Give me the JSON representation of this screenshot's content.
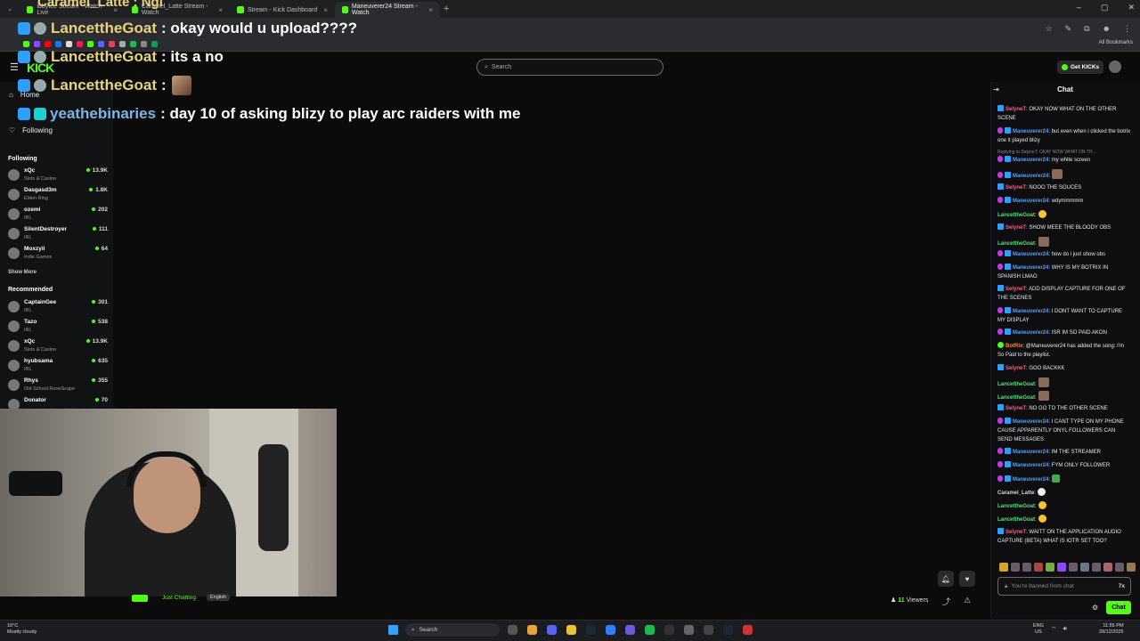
{
  "browser": {
    "tabs": [
      {
        "label": "ibbytee Stream - Watch Live"
      },
      {
        "label": "Caramel_Latte Stream - Watch"
      },
      {
        "label": "Stream - Kick Dashboard"
      },
      {
        "label": "Maneuverer24 Stream - Watch"
      }
    ],
    "all_bookmarks": "All Bookmarks"
  },
  "kick": {
    "logo": "KICK",
    "search_placeholder": "Search",
    "get_kicks": "Get KICKs"
  },
  "sidebar": {
    "nav": [
      {
        "label": "Home"
      },
      {
        "label": "Following"
      }
    ],
    "following_heading": "Following",
    "following": [
      {
        "name": "xQc",
        "category": "Slots & Casino",
        "viewers": "13.9K"
      },
      {
        "name": "Dasgasd3m",
        "category": "Elden Ring",
        "viewers": "1.8K"
      },
      {
        "name": "ozemi",
        "category": "IRL",
        "viewers": "202"
      },
      {
        "name": "SilentDestroyer",
        "category": "IRL",
        "viewers": "111"
      },
      {
        "name": "Moxzyii",
        "category": "Indie Games",
        "viewers": "64"
      }
    ],
    "show_more": "Show More",
    "recommended_heading": "Recommended",
    "recommended": [
      {
        "name": "CaptainGee",
        "category": "IRL",
        "viewers": "301"
      },
      {
        "name": "Tazo",
        "category": "IRL",
        "viewers": "538"
      },
      {
        "name": "xQc",
        "category": "Slots & Casino",
        "viewers": "13.9K"
      },
      {
        "name": "hyubsama",
        "category": "IRL",
        "viewers": "635"
      },
      {
        "name": "Rhys",
        "category": "Old School RuneScape",
        "viewers": "355"
      },
      {
        "name": "Donator",
        "category": "",
        "viewers": "70"
      }
    ]
  },
  "overlay": {
    "title_bleed": "Caramel_Latte : Ngl",
    "messages": [
      {
        "user": "LancettheGoat",
        "text": ": okay would u upload????"
      },
      {
        "user": "LancettheGoat",
        "text": ": its a no"
      },
      {
        "user": "LancettheGoat",
        "text": ":"
      },
      {
        "user": "yeathebinaries",
        "text": ": day 10 of asking blizy to play arc raiders with me"
      }
    ]
  },
  "stream": {
    "category": "Just Chatting",
    "language": "English",
    "viewers_count": "11",
    "viewers_label": "Viewers"
  },
  "chat": {
    "title": "Chat",
    "reply_hint": "Replying to SelyneT: OKAY NOW WHAT ON TH...",
    "messages": [
      {
        "user": "SelyneT",
        "cls": "sel",
        "badge": "b1",
        "text": ": OKAY NOW WHAT ON THE OTHER SCENE"
      },
      {
        "user": "Maneuverer24",
        "cls": "man",
        "badge": "b2",
        "text": ": but even when i clicked the botrix one it played blizy"
      },
      {
        "user": "Maneuverer24",
        "cls": "man",
        "badge": "b2",
        "text": ": my white screen"
      },
      {
        "user": "Maneuverer24",
        "cls": "man",
        "badge": "b2",
        "text": ":",
        "emote": "pic"
      },
      {
        "user": "SelyneT",
        "cls": "sel",
        "badge": "b1",
        "text": ": NOOO THE SOUCES"
      },
      {
        "user": "Maneuverer24",
        "cls": "man",
        "badge": "b2",
        "text": ": wdymmmmm"
      },
      {
        "user": "LancettheGoat",
        "cls": "lan",
        "badge": "",
        "text": ":",
        "emote": "yel"
      },
      {
        "user": "SelyneT",
        "cls": "sel",
        "badge": "b1",
        "text": ": SHOW MEEE THE BLOODY OBS"
      },
      {
        "user": "LancettheGoat",
        "cls": "lan",
        "badge": "",
        "text": ":",
        "emote": "pic"
      },
      {
        "user": "Maneuverer24",
        "cls": "man",
        "badge": "b2",
        "text": ": how do i just show obs"
      },
      {
        "user": "Maneuverer24",
        "cls": "man",
        "badge": "b2",
        "text": ": WHY IS MY BOTRIX IN SPANISH LMAO"
      },
      {
        "user": "SelyneT",
        "cls": "sel",
        "badge": "b1",
        "text": ": ADD DISPLAY CAPTURE FOR ONE OF THE SCENES"
      },
      {
        "user": "Maneuverer24",
        "cls": "man",
        "badge": "b2",
        "text": ": I DONT WANT TO CAPTURE MY DISPLAY"
      },
      {
        "user": "Maneuverer24",
        "cls": "man",
        "badge": "b2",
        "text": ": ISR IM SO PAID AKON"
      },
      {
        "user": "BotRix",
        "cls": "bot",
        "badge": "b3",
        "text": ": @Maneuverer24 has added the song: I'm So Paid to the playlist."
      },
      {
        "user": "SelyneT",
        "cls": "sel",
        "badge": "b1",
        "text": ": GOO BACKKK"
      },
      {
        "user": "LancettheGoat",
        "cls": "lan",
        "badge": "",
        "text": ":",
        "emote": "pic"
      },
      {
        "user": "LancettheGoat",
        "cls": "lan",
        "badge": "",
        "text": ":",
        "emote": "pic"
      },
      {
        "user": "SelyneT",
        "cls": "sel",
        "badge": "b1",
        "text": ": NO GO TO THE OTHER SCENE"
      },
      {
        "user": "Maneuverer24",
        "cls": "man",
        "badge": "b2",
        "text": ": I CANT TYPE ON MY PHONE CAUSE APPARENTLY ONYL FOLLOWERS CAN SEND MESSAGES"
      },
      {
        "user": "Maneuverer24",
        "cls": "man",
        "badge": "b2",
        "text": ": IM THE STREAMER"
      },
      {
        "user": "Maneuverer24",
        "cls": "man",
        "badge": "b2",
        "text": ": FYM ONLY FOLLOWER"
      },
      {
        "user": "Maneuverer24",
        "cls": "man",
        "badge": "b2",
        "text": ":",
        "emote": "grn"
      },
      {
        "user": "Caramel_Latte",
        "cls": "car",
        "badge": "",
        "text": ":",
        "emote": "wht"
      },
      {
        "user": "LancettheGoat",
        "cls": "lan",
        "badge": "",
        "text": ":",
        "emote": "yel"
      },
      {
        "user": "LancettheGoat",
        "cls": "lan",
        "badge": "",
        "text": ":",
        "emote": "yel"
      },
      {
        "user": "SelyneT",
        "cls": "sel",
        "badge": "b1",
        "text": ": WAITT ON THE APPLICATION AUDIO CAPTURE (BETA) WHAT IS IOTR SET TOO?"
      }
    ],
    "input_placeholder": "You're banned from chat",
    "input_counter": "7x",
    "send_label": "Chat"
  },
  "taskbar": {
    "temp": "16°C",
    "weather": "Mostly cloudy",
    "search": "Search",
    "lang_top": "ENG",
    "lang_bottom": "US",
    "time": "11:55 PM",
    "date": "29/12/2025"
  },
  "colors": {
    "kick_green": "#53fc18",
    "accent_blue": "#2e9fff"
  }
}
